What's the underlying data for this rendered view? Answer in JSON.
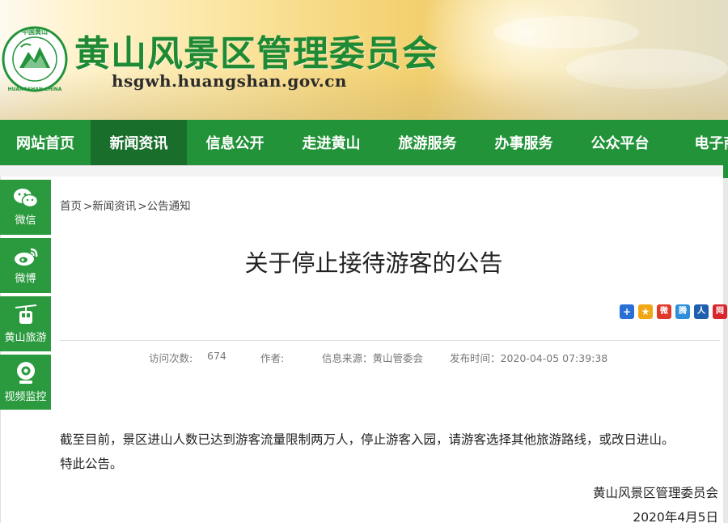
{
  "header": {
    "site_title": "黄山风景区管理委员会",
    "site_url": "hsgwh.huangshan.gov.cn",
    "logo_text_top": "中国黄山",
    "logo_text_bottom": "HUANGSHAN CHINA"
  },
  "nav": {
    "items": [
      {
        "label": "网站首页",
        "active": false
      },
      {
        "label": "新闻资讯",
        "active": true
      },
      {
        "label": "信息公开",
        "active": false
      },
      {
        "label": "走进黄山",
        "active": false
      },
      {
        "label": "旅游服务",
        "active": false
      },
      {
        "label": "办事服务",
        "active": false
      },
      {
        "label": "公众平台",
        "active": false
      },
      {
        "label": "电子商",
        "active": false
      }
    ]
  },
  "sidebar": {
    "items": [
      {
        "label": "微信",
        "icon": "wechat-icon"
      },
      {
        "label": "微博",
        "icon": "weibo-icon"
      },
      {
        "label": "黄山旅游",
        "icon": "cable-car-icon"
      },
      {
        "label": "视频监控",
        "icon": "camera-icon"
      }
    ]
  },
  "breadcrumb": {
    "home": "首页",
    "news": ">新闻资讯",
    "notice": ">公告通知"
  },
  "article": {
    "title": "关于停止接待游客的公告",
    "meta": {
      "visits_label": "访问次数:",
      "visits_value": "674",
      "author_label": "作者:",
      "source": "信息来源：黄山管委会",
      "published": "发布时间：2020-04-05 07:39:38"
    },
    "paragraphs": [
      "截至目前，景区进山人数已达到游客流量限制两万人，停止游客入园，请游客选择其他旅游路线，或改日进山。",
      "特此公告。"
    ],
    "signature_org": "黄山风景区管理委员会",
    "signature_date": "2020年4月5日"
  },
  "share": {
    "buttons": [
      {
        "icon": "share-more-icon",
        "color": "#2a6fd6",
        "glyph": "+"
      },
      {
        "icon": "qzone-icon",
        "color": "#f1a817",
        "glyph": "★"
      },
      {
        "icon": "weibo-share-icon",
        "color": "#e0392c",
        "glyph": "微"
      },
      {
        "icon": "tencent-weibo-icon",
        "color": "#2f8ed8",
        "glyph": "腾"
      },
      {
        "icon": "renren-icon",
        "color": "#1f5fae",
        "glyph": "人"
      },
      {
        "icon": "netease-icon",
        "color": "#d7262e",
        "glyph": "网"
      }
    ]
  },
  "colors": {
    "brand_green": "#23933a",
    "nav_active": "#1a6e2b",
    "title_green": "#1e8a33"
  }
}
